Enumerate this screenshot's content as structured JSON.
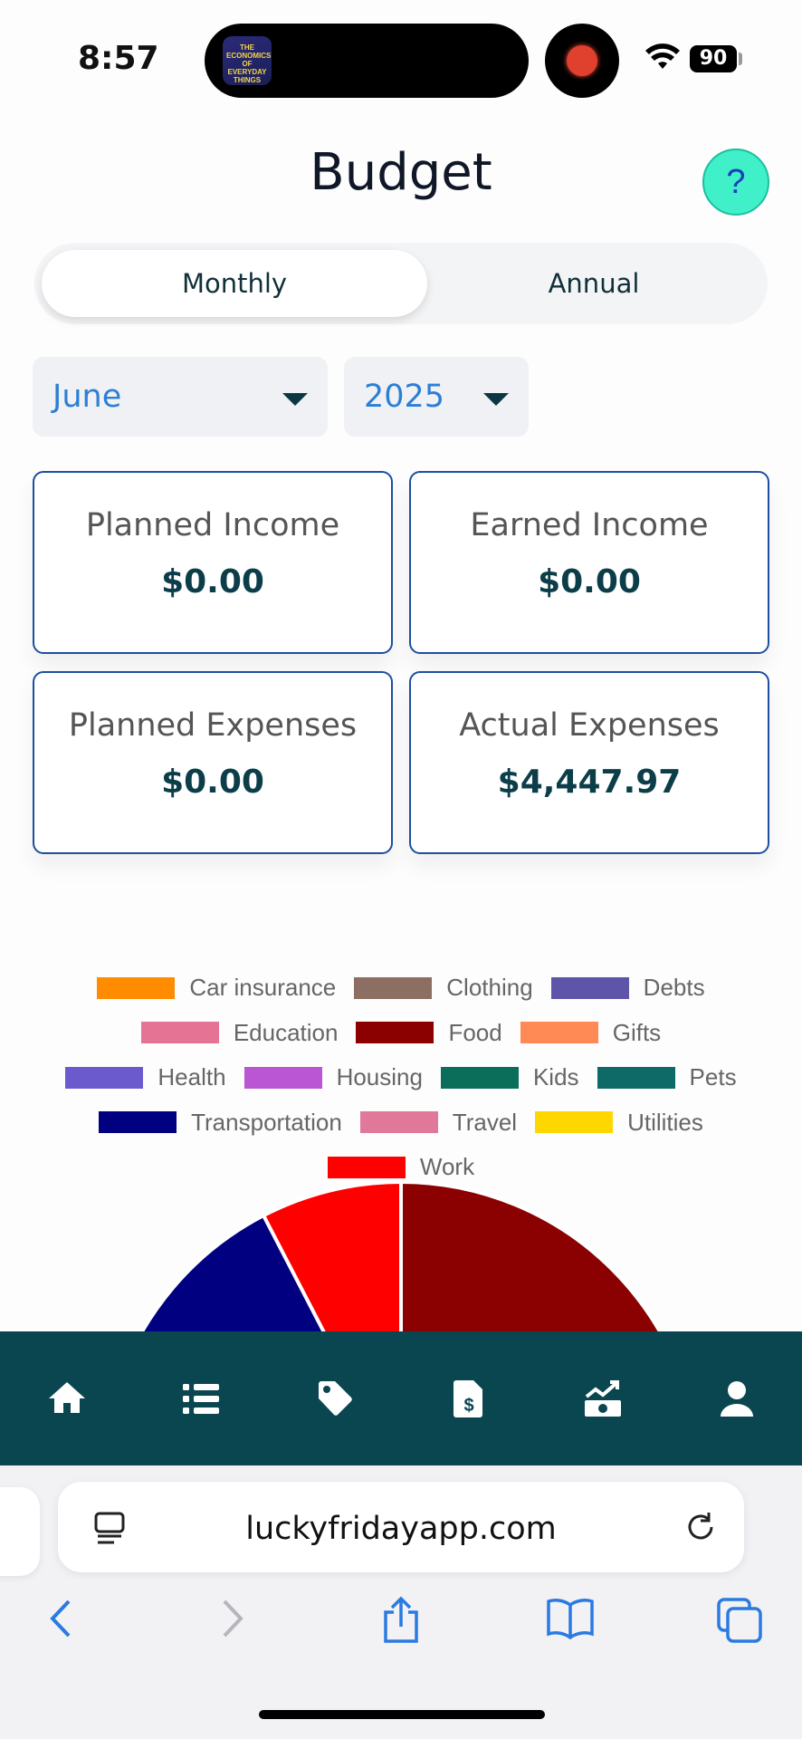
{
  "status_bar": {
    "time": "8:57",
    "battery": "90",
    "island_app_text": "THE ECONOMICS OF EVERYDAY THINGS"
  },
  "header": {
    "title": "Budget",
    "help_label": "?"
  },
  "view_toggle": {
    "options": [
      "Monthly",
      "Annual"
    ],
    "selected": "Monthly"
  },
  "filters": {
    "month": "June",
    "year": "2025"
  },
  "summary_cards": [
    {
      "label": "Planned Income",
      "value": "$0.00"
    },
    {
      "label": "Earned Income",
      "value": "$0.00"
    },
    {
      "label": "Planned Expenses",
      "value": "$0.00"
    },
    {
      "label": "Actual Expenses",
      "value": "$4,447.97"
    }
  ],
  "chart_data": {
    "type": "pie",
    "title": "",
    "legend_placement": "top",
    "categories": [
      "Car insurance",
      "Clothing",
      "Debts",
      "Education",
      "Food",
      "Gifts",
      "Health",
      "Housing",
      "Kids",
      "Pets",
      "Transportation",
      "Travel",
      "Utilities",
      "Work"
    ],
    "colors": [
      "#ff8c00",
      "#8d6e63",
      "#5e55ab",
      "#e57393",
      "#8b0000",
      "#ff8a55",
      "#6a5acd",
      "#ba55d3",
      "#0b6e5a",
      "#0d6a66",
      "#000080",
      "#e0789a",
      "#ffd700",
      "#ff0000"
    ],
    "values": [
      0,
      0,
      0.5,
      0,
      24,
      0,
      0,
      0,
      6,
      0,
      12,
      0,
      0,
      3.5
    ],
    "note_visible_partial": true
  },
  "app_nav": {
    "items": [
      "home-icon",
      "list-icon",
      "tag-icon",
      "invoice-icon",
      "cash-growth-icon",
      "user-icon"
    ]
  },
  "browser": {
    "url": "luckyfridayapp.com"
  }
}
